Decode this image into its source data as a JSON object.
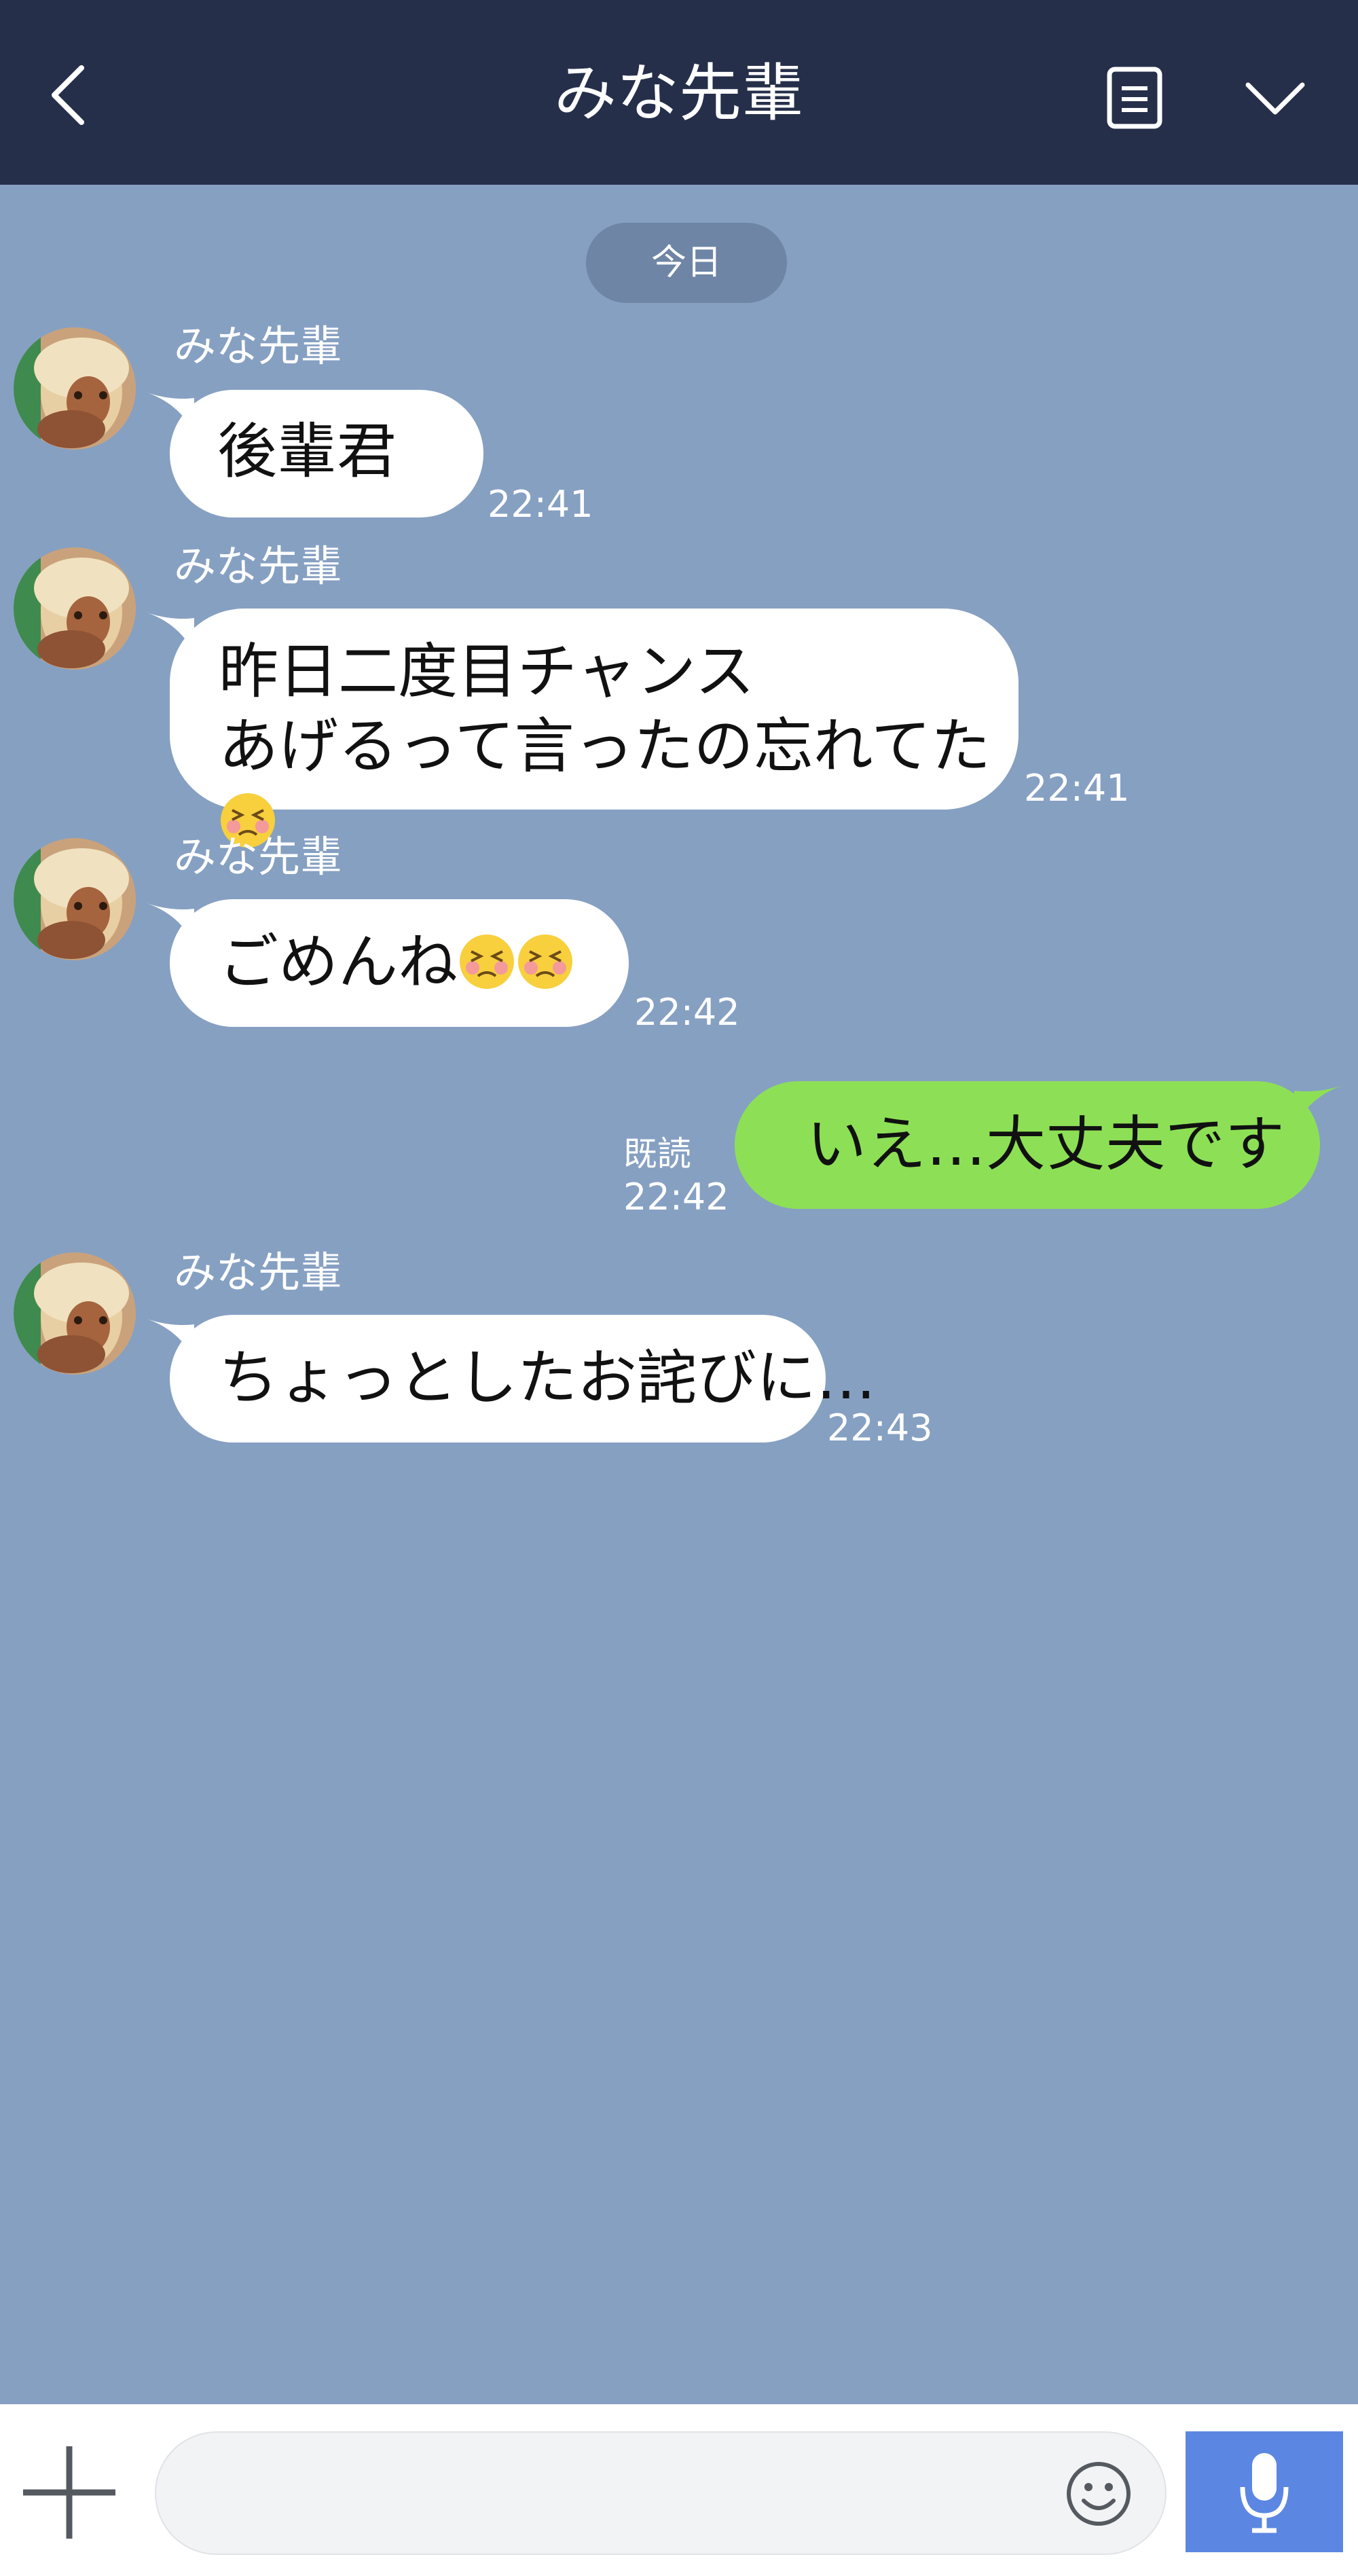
{
  "header": {
    "title": "みな先輩",
    "back_icon": "chevron-left-icon",
    "notes_icon": "document-icon",
    "menu_icon": "chevron-down-icon"
  },
  "date_divider": "今日",
  "messages": [
    {
      "sender": "みな先輩",
      "text": "後輩君",
      "time": "22:41"
    },
    {
      "sender": "みな先輩",
      "lines": [
        "昨日二度目チャンス",
        "あげるって言ったの忘れてた"
      ],
      "emoji": "😣",
      "time": "22:41"
    },
    {
      "sender": "みな先輩",
      "text": "ごめんね",
      "emoji": "😣😣",
      "time": "22:42"
    },
    {
      "text": "いえ…大丈夫です",
      "read": "既読",
      "time": "22:42"
    },
    {
      "sender": "みな先輩",
      "text": "ちょっとしたお詫びに…",
      "time": "22:43"
    }
  ],
  "input": {
    "value": "",
    "placeholder": ""
  },
  "footer": {
    "plus_icon": "plus-icon",
    "emoji_icon": "smiley-icon",
    "mic_icon": "microphone-icon"
  },
  "colors": {
    "header": "#262f4a",
    "chat_background": "#86a0c2",
    "incoming_bubble": "#ffffff",
    "outgoing_bubble": "#8de055",
    "send_button": "#5b87e2"
  }
}
